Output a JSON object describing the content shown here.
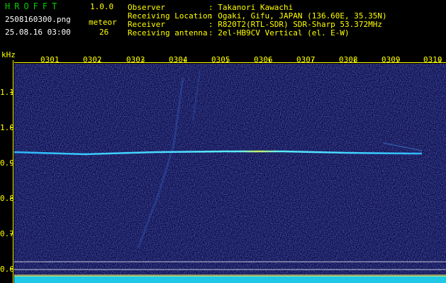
{
  "header": {
    "app_name": "HROFFT",
    "version": "1.0.0",
    "filename": "2508160300.png",
    "datetime": "25.08.16 03:00",
    "meteor_label": "meteor",
    "meteor_count": "26",
    "fields": [
      {
        "label": "Observer",
        "value": ": Takanori Kawachi"
      },
      {
        "label": "Receiving Location",
        "value": ": Ogaki, Gifu, JAPAN (136.60E, 35.35N)"
      },
      {
        "label": "Receiver",
        "value": ": R820T2(RTL-SDR) SDR-Sharp 53.372MHz"
      },
      {
        "label": "Receiving antenna",
        "value": ": 2el-HB9CV Vertical (el. E-W)"
      }
    ]
  },
  "axis": {
    "unit": "kHz",
    "y_ticks": [
      "1.1",
      "1.0",
      "0.9",
      "0.8",
      "0.7",
      "0.6"
    ],
    "x_ticks": [
      "0301",
      "0302",
      "0303",
      "0304",
      "0305",
      "0306",
      "0307",
      "0308",
      "0309",
      "0310"
    ]
  },
  "colors": {
    "background": "#070742",
    "axis": "#ffff00",
    "trace": "#3fd8ff"
  }
}
